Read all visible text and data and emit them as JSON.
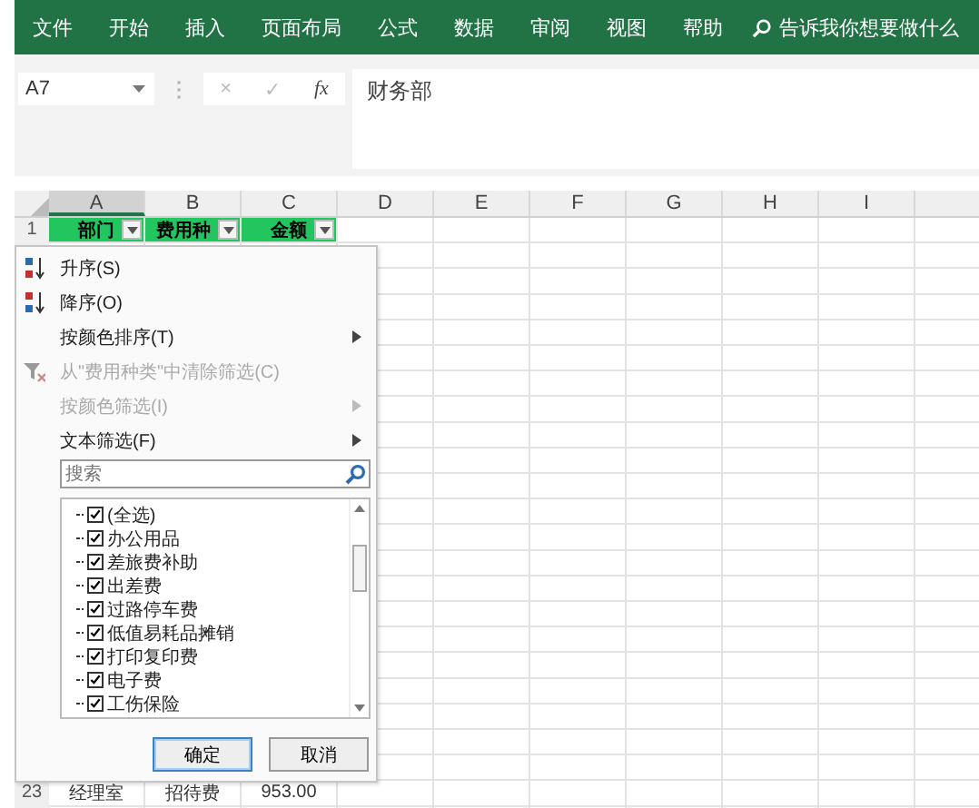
{
  "ribbon": {
    "tabs": [
      {
        "label": "文件",
        "selected": false
      },
      {
        "label": "开始",
        "selected": false
      },
      {
        "label": "插入",
        "selected": false
      },
      {
        "label": "页面布局",
        "selected": false
      },
      {
        "label": "公式",
        "selected": false
      },
      {
        "label": "数据",
        "selected": false
      },
      {
        "label": "审阅",
        "selected": false
      },
      {
        "label": "视图",
        "selected": false
      },
      {
        "label": "帮助",
        "selected": false
      }
    ],
    "tell_me": "告诉我你想要做什么"
  },
  "formula_bar": {
    "name_box": "A7",
    "cancel": "×",
    "enter": "✓",
    "fx": "fx",
    "value": "财务部"
  },
  "columns": [
    "A",
    "B",
    "C",
    "D",
    "E",
    "F",
    "G",
    "H",
    "I"
  ],
  "header_row": {
    "number": "1",
    "cells": [
      {
        "text": "部门",
        "filter": true
      },
      {
        "text": "费用种",
        "filter": true
      },
      {
        "text": "金额",
        "filter": true
      }
    ]
  },
  "last_row": {
    "number": "23",
    "cells": [
      "经理室",
      "招待费",
      "953.00"
    ]
  },
  "filter_menu": {
    "items": [
      {
        "label": "升序(S)",
        "kind": "sort-asc",
        "submenu": false,
        "disabled": false
      },
      {
        "label": "降序(O)",
        "kind": "sort-desc",
        "submenu": false,
        "disabled": false
      },
      {
        "label": "按颜色排序(T)",
        "kind": "plain",
        "submenu": true,
        "disabled": false
      },
      {
        "label": "从\"费用种类\"中清除筛选(C)",
        "kind": "clear",
        "submenu": false,
        "disabled": true
      },
      {
        "label": "按颜色筛选(I)",
        "kind": "plain",
        "submenu": true,
        "disabled": true
      },
      {
        "label": "文本筛选(F)",
        "kind": "plain",
        "submenu": true,
        "disabled": false
      }
    ],
    "search": {
      "placeholder": "搜索"
    },
    "values": [
      {
        "label": "(全选)",
        "checked": true
      },
      {
        "label": "办公用品",
        "checked": true
      },
      {
        "label": "差旅费补助",
        "checked": true
      },
      {
        "label": "出差费",
        "checked": true
      },
      {
        "label": "过路停车费",
        "checked": true
      },
      {
        "label": "低值易耗品摊销",
        "checked": true
      },
      {
        "label": "打印复印费",
        "checked": true
      },
      {
        "label": "电子费",
        "checked": true
      },
      {
        "label": "工伤保险",
        "checked": true
      }
    ],
    "buttons": [
      {
        "label": "确定",
        "default": true
      },
      {
        "label": "取消",
        "default": false
      }
    ]
  }
}
